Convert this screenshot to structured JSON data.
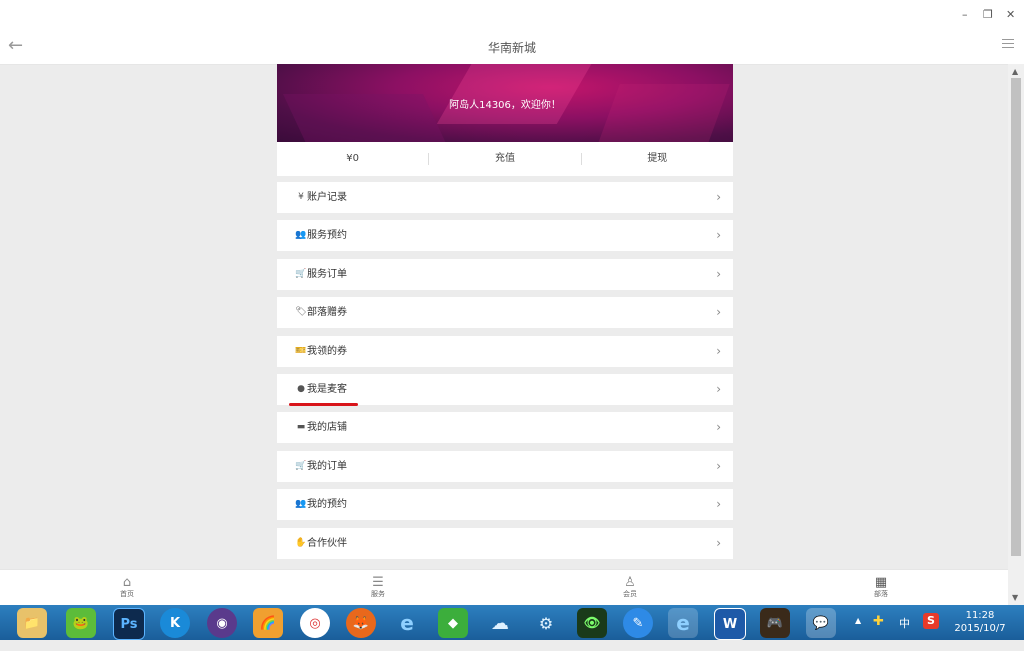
{
  "window": {
    "minimize": "–",
    "restore": "❐",
    "close": "✕"
  },
  "header": {
    "back": "←",
    "title": "华南新城"
  },
  "banner": {
    "welcome": "阿岛人14306，欢迎你！"
  },
  "stats": {
    "balance": "¥0",
    "recharge": "充值",
    "withdraw": "提现"
  },
  "menu": {
    "items": [
      {
        "icon": "¥",
        "label": "账户记录"
      },
      {
        "icon": "👥",
        "label": "服务预约"
      },
      {
        "icon": "🛒",
        "label": "服务订单"
      },
      {
        "icon": "🏷",
        "label": "部落赠券"
      },
      {
        "icon": "🎫",
        "label": "我领的券"
      },
      {
        "icon": "●",
        "label": "我是麦客"
      },
      {
        "icon": "▬",
        "label": "我的店铺"
      },
      {
        "icon": "🛒",
        "label": "我的订单"
      },
      {
        "icon": "👥",
        "label": "我的预约"
      },
      {
        "icon": "✋",
        "label": "合作伙伴"
      }
    ],
    "chevron": "›"
  },
  "bottom_nav": {
    "home": "首页",
    "service": "服务",
    "member": "会员",
    "tribe": "部落"
  },
  "taskbar": {
    "apps": [
      "📁",
      "🐸",
      "Ps",
      "K",
      "◉",
      "🌈",
      "◎",
      "🦊",
      "e",
      "◆",
      "☁",
      "⚙",
      "👁",
      "✎",
      "e",
      "W",
      "🎮",
      "💬"
    ],
    "tray": {
      "arrow": "▲",
      "ime": "中",
      "sogou": "S"
    },
    "time": "11:28",
    "date": "2015/10/7"
  },
  "colors": {
    "underline": "#d8141a",
    "taskbar": "#1a5e9a"
  }
}
